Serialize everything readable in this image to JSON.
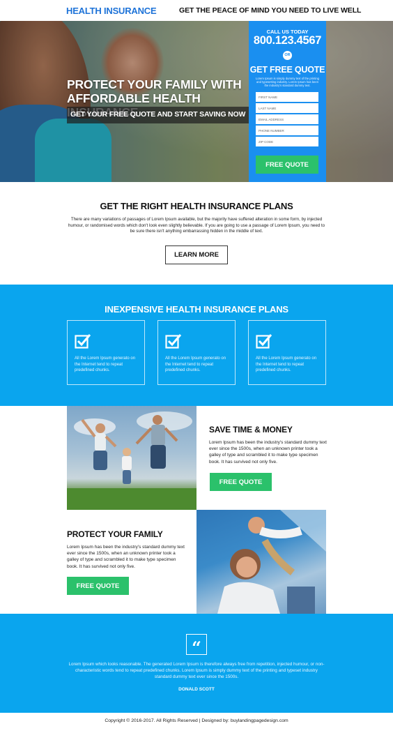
{
  "header": {
    "logo": "HEALTH INSURANCE",
    "tagline": "GET THE PEACE OF MIND YOU NEED TO LIVE WELL"
  },
  "hero": {
    "title": "PROTECT YOUR FAMILY WITH AFFORDABLE HEALTH INSURANCE",
    "subtitle": "GET YOUR FREE QUOTE AND START SAVING NOW"
  },
  "quote_form": {
    "call_label": "CALL US TODAY",
    "phone": "800.123.4567",
    "or": "OR",
    "title": "GET FREE QUOTE",
    "description": "Lorem Ipsum is simply dummy text of the printing and typesetting industry. Lorem Ipsum has been the industry's standard dummy text.",
    "fields": {
      "first_name": "FIRST NAME",
      "last_name": "LAST NAME",
      "email": "EMAIL ADDRESS",
      "phone": "PHONE NUMBER",
      "zip": "ZIP CODE"
    },
    "submit_label": "FREE QUOTE"
  },
  "plans": {
    "title": "GET THE RIGHT HEALTH INSURANCE PLANS",
    "text": "There are many variations of passages of Lorem Ipsum available, but the majority have suffered alteration in some form, by injected humour, or randomised words which don't look even slightly believable. If you are going to use a passage of Lorem Ipsum, you need to be sure there isn't anything embarrassing hidden in the middle of text.",
    "button_label": "LEARN MORE"
  },
  "inexpensive": {
    "title": "INEXPENSIVE HEALTH INSURANCE PLANS",
    "features": [
      {
        "icon": "checkbox-icon",
        "text": "All the Lorem Ipsum generato on the Internet tend to repeat predefined chunks."
      },
      {
        "icon": "checkbox-icon",
        "text": "All the Lorem Ipsum generato on the Internet tend to repeat predefined chunks."
      },
      {
        "icon": "checkbox-icon",
        "text": "All the Lorem Ipsum generato on the Internet tend to repeat predefined chunks."
      }
    ]
  },
  "save": {
    "title": "SAVE TIME & MONEY",
    "text": "Lorem Ipsum has been the industry's standard dummy text ever since the 1500s, when an unknown printer took a galley of type and scrambled it to make type specimen book. It has survived not only five.",
    "button_label": "FREE QUOTE"
  },
  "protect": {
    "title": "PROTECT YOUR FAMILY",
    "text": "Lorem Ipsum has been the industry's standard dummy text ever since the 1500s, when an unknown printer took a galley of type and scrambled it to make type specimen book. It has survived not only five.",
    "button_label": "FREE QUOTE"
  },
  "testimonial": {
    "quote_mark": "“",
    "text": "Lorem Ipsum which looks reasonable. The generated Lorem Ipsum is therefore always free from repetition, injected humour, or non-characteristic words tend to repeat predefined chunks. Lorem Ipsum is simply dummy text of the printing and typeset industry standard dummy text ever since the 1500s.",
    "author": "DONALD SCOTT"
  },
  "footer": {
    "text": "Copyright © 2016-2017. All Rights Reserved  |  Designed by: buylandingpagedesign.com"
  },
  "colors": {
    "brand_blue": "#1e73d8",
    "band_blue": "#0aa5ee",
    "form_blue": "#1a8ff0",
    "cta_green": "#2bc16b"
  }
}
